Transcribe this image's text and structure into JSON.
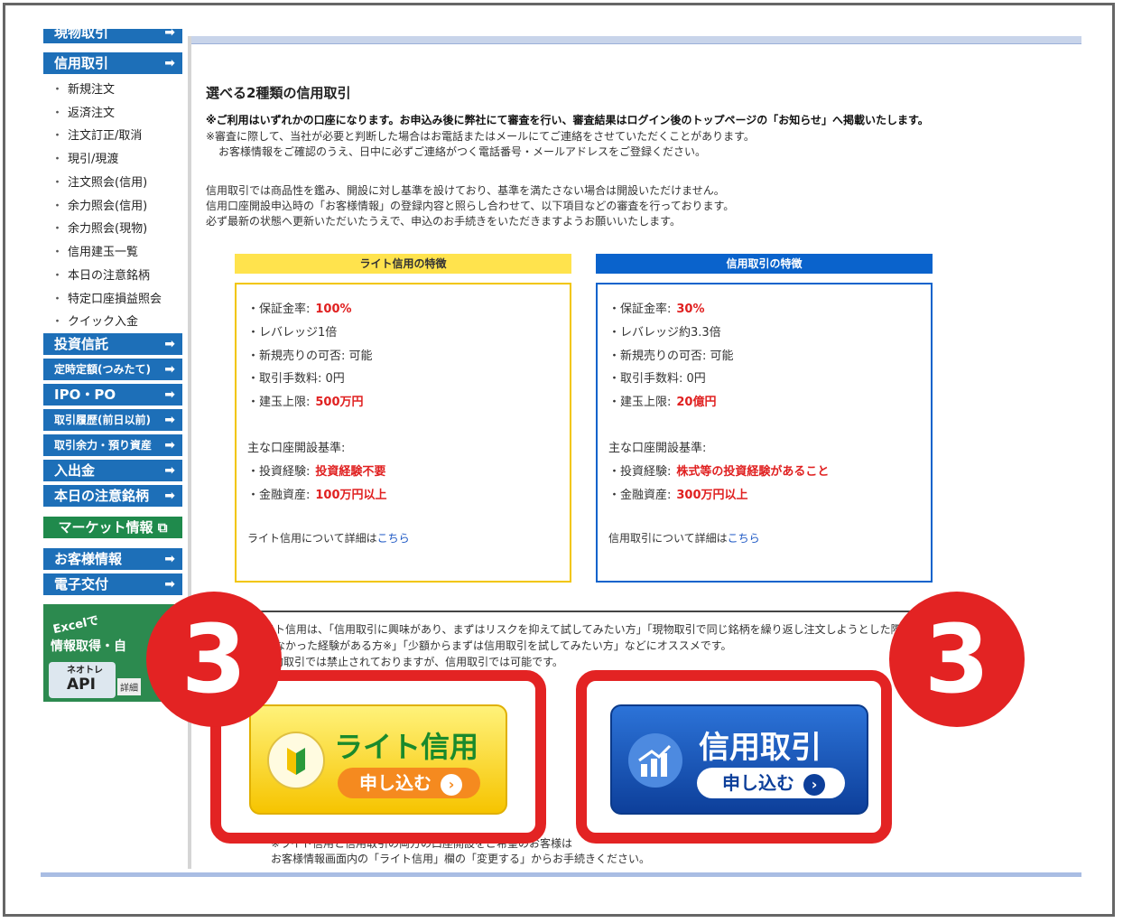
{
  "sidebar": {
    "top_cut": "現物取引",
    "shinyo": "信用取引",
    "sub_items": [
      "新規注文",
      "返済注文",
      "注文訂正/取消",
      "現引/現渡",
      "注文照会(信用)",
      "余力照会(信用)",
      "余力照会(現物)",
      "信用建玉一覧",
      "本日の注意銘柄",
      "特定口座損益照会",
      "クイック入金"
    ],
    "buttons": [
      "投資信託",
      "定時定額(つみたて)",
      "IPO・PO",
      "取引履歴(前日以前)",
      "取引余力・預り資産",
      "入出金",
      "本日の注意銘柄"
    ],
    "market": "マーケット情報",
    "lower": [
      "お客様情報",
      "電子交付"
    ],
    "excel_label": "Excelで",
    "excel_sub": "情報取得・自",
    "api_label1": "ネオトレ",
    "api_label2": "API",
    "detail": "詳細"
  },
  "main": {
    "title": "選べる2種類の信用取引",
    "note_bold": "※ご利用はいずれかの口座になります。お申込み後に弊社にて審査を行い、審査結果はログイン後のトップページの「お知らせ」へ掲載いたします。",
    "note1": "※審査に際して、当社が必要と判断した場合はお電話またはメールにてご連絡をさせていただくことがあります。",
    "note2": "お客様情報をご確認のうえ、日中に必ずご連絡がつく電話番号・メールアドレスをご登録ください。",
    "para1": "信用取引では商品性を鑑み、開設に対し基準を設けており、基準を満たさない場合は開設いただけません。",
    "para2": "信用口座開設申込時の「お客様情報」の登録内容と照らし合わせて、以下項目などの審査を行っております。",
    "para3": "必ず最新の状態へ更新いただいたうえで、申込のお手続きをいただきますようお願いいたします。"
  },
  "lite_card": {
    "header": "ライト信用の特徴",
    "margin_label": "・保証金率:",
    "margin_value": "100%",
    "leverage": "・レバレッジ1倍",
    "short": "・新規売りの可否: 可能",
    "fee": "・取引手数料: 0円",
    "limit_label": "・建玉上限:",
    "limit_value": "500万円",
    "criteria": "主な口座開設基準:",
    "exp_label": "・投資経験:",
    "exp_value": "投資経験不要",
    "asset_label": "・金融資産:",
    "asset_value": "100万円以上",
    "detail_text": "ライト信用について詳細は",
    "detail_link": "こちら"
  },
  "margin_card": {
    "header": "信用取引の特徴",
    "margin_label": "・保証金率:",
    "margin_value": "30%",
    "leverage": "・レバレッジ約3.3倍",
    "short": "・新規売りの可否: 可能",
    "fee": "・取引手数料: 0円",
    "limit_label": "・建玉上限:",
    "limit_value": "20億円",
    "criteria": "主な口座開設基準:",
    "exp_label": "・投資経験:",
    "exp_value": "株式等の投資経験があること",
    "asset_label": "・金融資産:",
    "asset_value": "300万円以上",
    "detail_text": "信用取引について詳細は",
    "detail_link": "こちら"
  },
  "desc": {
    "line1": "ライト信用は、「信用取引に興味があり、まずはリスクを抑えて試してみたい方」「現物取引で同じ銘柄を繰り返し注文しようとした際",
    "line2": "できなかった経験がある方※」「少額からまずは信用取引を試してみたい方」などにオススメです。",
    "line3": "※現物取引では禁止されておりますが、信用取引では可能です。"
  },
  "cta": {
    "step": "3",
    "lite_title": "ライト信用",
    "lite_apply": "申し込む",
    "margin_title": "信用取引",
    "margin_apply": "申し込む"
  },
  "bottom": {
    "line1": "※ライト信用と信用取引の両方の口座開設をご希望のお客様は",
    "line2": "お客様情報画面内の「ライト信用」欄の「変更する」からお手続きください。"
  },
  "colors": {
    "nav_blue": "#1d6fb8",
    "accent_red": "#e32323",
    "lite_yellow": "#ffe34d",
    "margin_blue": "#0a63cc"
  }
}
